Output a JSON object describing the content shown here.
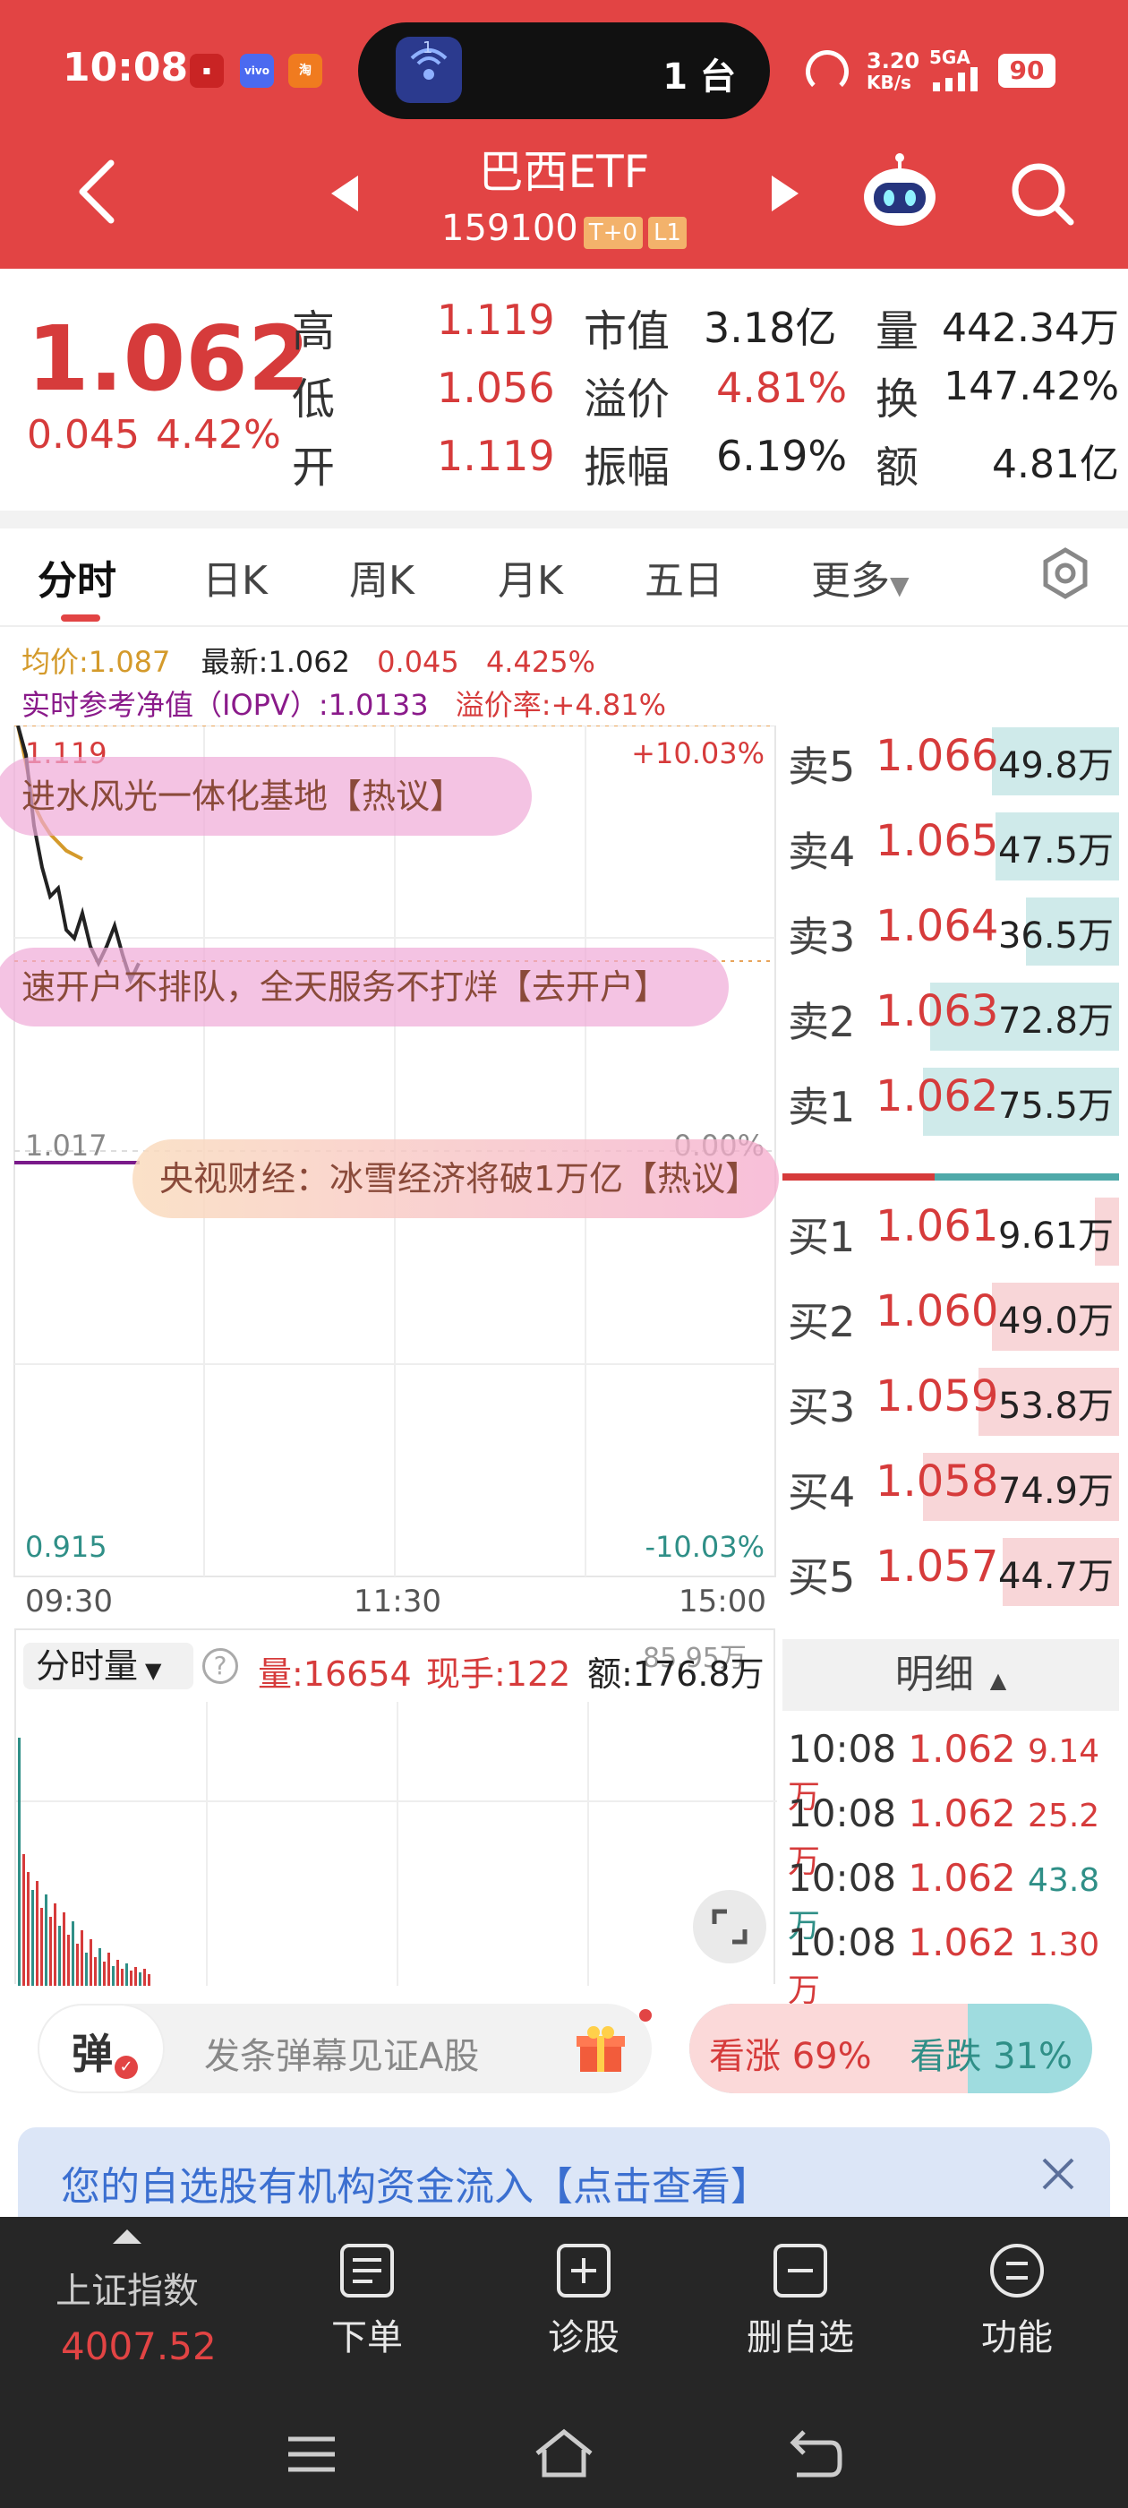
{
  "status_bar": {
    "time": "10:08",
    "pill_count": "1 台",
    "pill_badge": "1",
    "speed_value": "3.20",
    "speed_unit": "KB/s",
    "network": "5GA",
    "battery": "90",
    "notif_icons": [
      "news-icon",
      "vivo-icon",
      "taobao-icon"
    ]
  },
  "header": {
    "title": "巴西ETF",
    "code": "159100",
    "tag_t0": "T+0",
    "tag_l1": "L1"
  },
  "quote": {
    "price": "1.062",
    "change": "0.045",
    "change_pct": "4.42%",
    "stats": [
      {
        "label": "高",
        "value": "1.119",
        "color": "red"
      },
      {
        "label": "低",
        "value": "1.056",
        "color": "red"
      },
      {
        "label": "开",
        "value": "1.119",
        "color": "red"
      },
      {
        "label": "市值",
        "value": "3.18亿",
        "color": "dark"
      },
      {
        "label": "溢价",
        "value": "4.81%",
        "color": "red"
      },
      {
        "label": "振幅",
        "value": "6.19%",
        "color": "dark"
      },
      {
        "label": "量",
        "value": "442.34万",
        "color": "dark"
      },
      {
        "label": "换",
        "value": "147.42%",
        "color": "dark"
      },
      {
        "label": "额",
        "value": "4.81亿",
        "color": "dark"
      }
    ]
  },
  "tabs": [
    "分时",
    "日K",
    "周K",
    "月K",
    "五日",
    "更多"
  ],
  "chart_info": {
    "avg": "均价:1.087",
    "latest": "最新:1.062",
    "chg": "0.045",
    "chg_pct": "4.425%",
    "iopv": "实时参考净值（IOPV）:1.0133",
    "premium": "溢价率:+4.81%"
  },
  "annotations": [
    "进水风光一体化基地【热议】",
    "速开户不排队，全天服务不打烊【去开户】",
    "央视财经：冰雪经济将破1万亿【热议】"
  ],
  "chart_data": {
    "type": "line",
    "y_labels": {
      "top": "1.119",
      "mid": "1.017",
      "bottom": "0.915"
    },
    "pct_labels": {
      "top": "+10.03%",
      "mid": "0.00%",
      "bottom": "-10.03%"
    },
    "x_labels": [
      "09:30",
      "11:30",
      "15:00"
    ],
    "ylim": [
      0.915,
      1.119
    ],
    "series": [
      {
        "values": [
          1.119,
          1.112,
          1.095,
          1.085,
          1.078,
          1.08,
          1.07,
          1.068,
          1.074,
          1.066,
          1.062,
          1.066,
          1.071,
          1.064,
          1.058,
          1.062
        ]
      },
      {
        "values": [
          1.119,
          1.11,
          1.1,
          1.096,
          1.093,
          1.091,
          1.089,
          1.088,
          1.087
        ]
      }
    ]
  },
  "volume_panel": {
    "selector": "分时量",
    "vol": "量:16654",
    "hand": "现手:122",
    "amount": "额:176.8万",
    "scale": "85.95万"
  },
  "order_book": {
    "asks": [
      {
        "label": "卖5",
        "price": "1.066",
        "vol": "49.8万",
        "bar": 0.37
      },
      {
        "label": "卖4",
        "price": "1.065",
        "vol": "47.5万",
        "bar": 0.36
      },
      {
        "label": "卖3",
        "price": "1.064",
        "vol": "36.5万",
        "bar": 0.27
      },
      {
        "label": "卖2",
        "price": "1.063",
        "vol": "72.8万",
        "bar": 0.55
      },
      {
        "label": "卖1",
        "price": "1.062",
        "vol": "75.5万",
        "bar": 0.57
      }
    ],
    "bids": [
      {
        "label": "买1",
        "price": "1.061",
        "vol": "9.61万",
        "bar": 0.07
      },
      {
        "label": "买2",
        "price": "1.060",
        "vol": "49.0万",
        "bar": 0.37
      },
      {
        "label": "买3",
        "price": "1.059",
        "vol": "53.8万",
        "bar": 0.41
      },
      {
        "label": "买4",
        "price": "1.058",
        "vol": "74.9万",
        "bar": 0.57
      },
      {
        "label": "买5",
        "price": "1.057",
        "vol": "44.7万",
        "bar": 0.34
      }
    ]
  },
  "detail": {
    "header": "明细",
    "rows": [
      {
        "time": "10:08",
        "price": "1.062",
        "vol": "9.14万",
        "color": "red"
      },
      {
        "time": "10:08",
        "price": "1.062",
        "vol": "25.2万",
        "color": "red"
      },
      {
        "time": "10:08",
        "price": "1.062",
        "vol": "43.8万",
        "color": "green"
      },
      {
        "time": "10:08",
        "price": "1.062",
        "vol": "1.30万",
        "color": "red"
      }
    ]
  },
  "comment_bar": {
    "danmu_label": "弹",
    "placeholder": "发条弹幕见证A股",
    "up": "看涨 69%",
    "down": "看跌 31%",
    "up_ratio": 0.69
  },
  "banner": {
    "text": "您的自选股有机构资金流入【点击查看】"
  },
  "bottom_bar": {
    "index_name": "上证指数",
    "index_value": "4007.52",
    "items": [
      "下单",
      "诊股",
      "删自选",
      "功能"
    ]
  }
}
